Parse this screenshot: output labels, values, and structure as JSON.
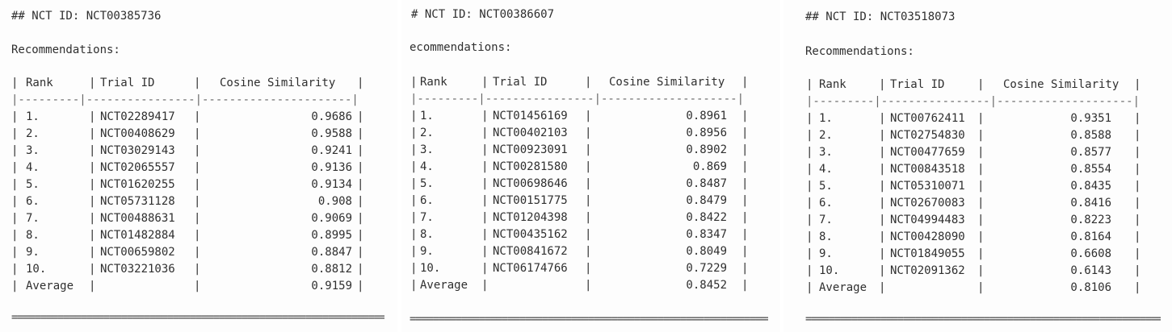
{
  "panels": [
    {
      "heading": "## NCT ID: NCT00385736",
      "recommendations_label": "Recommendations:",
      "columns": [
        "Rank",
        "Trial ID",
        "Cosine Similarity"
      ],
      "rows": [
        {
          "rank": "1.",
          "trial_id": "NCT02289417",
          "similarity": "0.9686"
        },
        {
          "rank": "2.",
          "trial_id": "NCT00408629",
          "similarity": "0.9588"
        },
        {
          "rank": "3.",
          "trial_id": "NCT03029143",
          "similarity": "0.9241"
        },
        {
          "rank": "4.",
          "trial_id": "NCT02065557",
          "similarity": "0.9136"
        },
        {
          "rank": "5.",
          "trial_id": "NCT01620255",
          "similarity": "0.9134"
        },
        {
          "rank": "6.",
          "trial_id": "NCT05731128",
          "similarity": "0.908"
        },
        {
          "rank": "7.",
          "trial_id": "NCT00488631",
          "similarity": "0.9069"
        },
        {
          "rank": "8.",
          "trial_id": "NCT01482884",
          "similarity": "0.8995"
        },
        {
          "rank": "9.",
          "trial_id": "NCT00659802",
          "similarity": "0.8847"
        },
        {
          "rank": "10.",
          "trial_id": "NCT03221036",
          "similarity": "0.8812"
        }
      ],
      "average_label": "Average",
      "average_value": "0.9159"
    },
    {
      "heading": "# NCT ID: NCT00386607",
      "recommendations_label": "ecommendations:",
      "columns": [
        "Rank",
        "Trial ID",
        "Cosine Similarity"
      ],
      "rows": [
        {
          "rank": "1.",
          "trial_id": "NCT01456169",
          "similarity": "0.8961"
        },
        {
          "rank": "2.",
          "trial_id": "NCT00402103",
          "similarity": "0.8956"
        },
        {
          "rank": "3.",
          "trial_id": "NCT00923091",
          "similarity": "0.8902"
        },
        {
          "rank": "4.",
          "trial_id": "NCT00281580",
          "similarity": "0.869"
        },
        {
          "rank": "5.",
          "trial_id": "NCT00698646",
          "similarity": "0.8487"
        },
        {
          "rank": "6.",
          "trial_id": "NCT00151775",
          "similarity": "0.8479"
        },
        {
          "rank": "7.",
          "trial_id": "NCT01204398",
          "similarity": "0.8422"
        },
        {
          "rank": "8.",
          "trial_id": "NCT00435162",
          "similarity": "0.8347"
        },
        {
          "rank": "9.",
          "trial_id": "NCT00841672",
          "similarity": "0.8049"
        },
        {
          "rank": "10.",
          "trial_id": "NCT06174766",
          "similarity": "0.7229"
        }
      ],
      "average_label": "Average",
      "average_value": "0.8452"
    },
    {
      "heading": "## NCT ID: NCT03518073",
      "recommendations_label": "Recommendations:",
      "columns": [
        "Rank",
        "Trial ID",
        "Cosine Similarity"
      ],
      "rows": [
        {
          "rank": "1.",
          "trial_id": "NCT00762411",
          "similarity": "0.9351"
        },
        {
          "rank": "2.",
          "trial_id": "NCT02754830",
          "similarity": "0.8588"
        },
        {
          "rank": "3.",
          "trial_id": "NCT00477659",
          "similarity": "0.8577"
        },
        {
          "rank": "4.",
          "trial_id": "NCT00843518",
          "similarity": "0.8554"
        },
        {
          "rank": "5.",
          "trial_id": "NCT05310071",
          "similarity": "0.8435"
        },
        {
          "rank": "6.",
          "trial_id": "NCT02670083",
          "similarity": "0.8416"
        },
        {
          "rank": "7.",
          "trial_id": "NCT04994483",
          "similarity": "0.8223"
        },
        {
          "rank": "8.",
          "trial_id": "NCT00428090",
          "similarity": "0.8164"
        },
        {
          "rank": "9.",
          "trial_id": "NCT01849055",
          "similarity": "0.6608"
        },
        {
          "rank": "10.",
          "trial_id": "NCT02091362",
          "similarity": "0.6143"
        }
      ],
      "average_label": "Average",
      "average_value": "0.8106"
    }
  ]
}
